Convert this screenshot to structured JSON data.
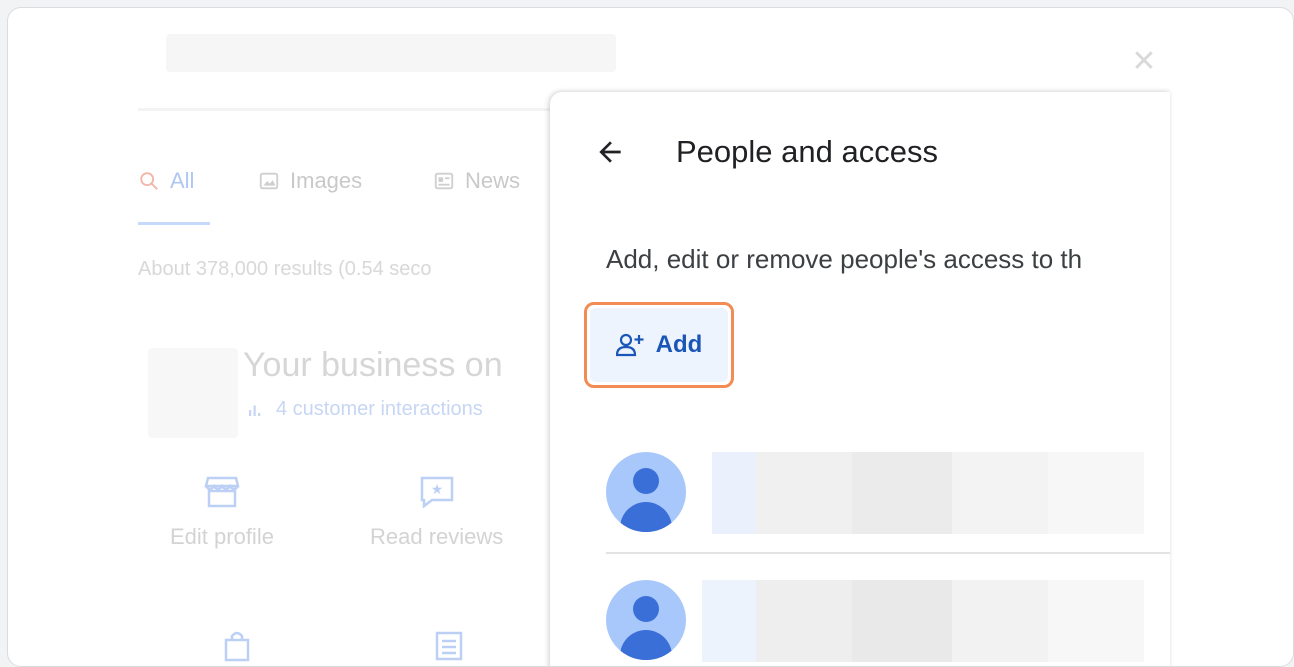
{
  "background": {
    "tabs": [
      {
        "icon": "search-icon",
        "label": "All"
      },
      {
        "icon": "image-icon",
        "label": "Images"
      },
      {
        "icon": "news-icon",
        "label": "News"
      }
    ],
    "results_text": "About 378,000 results (0.54 seco",
    "business_title": "Your business on",
    "interactions": "4 customer interactions",
    "actions": [
      {
        "icon": "storefront-icon",
        "label": "Edit profile"
      },
      {
        "icon": "review-icon",
        "label": "Read reviews"
      }
    ]
  },
  "panel": {
    "title": "People and access",
    "description": "Add, edit or remove people's access to th",
    "add_label": "Add"
  },
  "colors": {
    "accent": "#1a56b8",
    "highlight": "#f28b54",
    "avatar_bg": "#a8c7fa",
    "avatar_fg": "#3b6fd8"
  }
}
